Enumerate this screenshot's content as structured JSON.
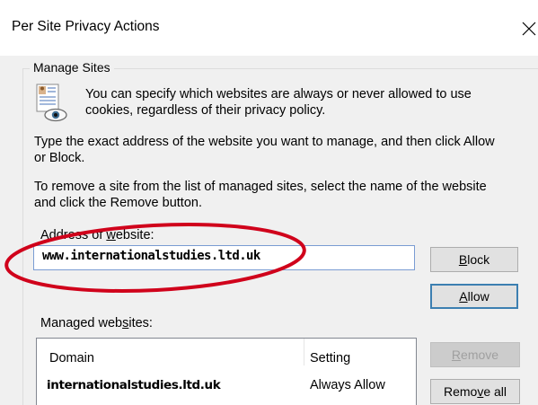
{
  "window": {
    "title": "Per Site Privacy Actions"
  },
  "manage_sites": {
    "legend": "Manage Sites",
    "info_line1": "You can specify which websites are always or never allowed to use",
    "info_line2": "cookies, regardless of their privacy policy.",
    "type_line1": "Type the exact address of the website you want to manage, and then click Allow",
    "type_line2": "or Block.",
    "remove_line1": "To remove a site from the list of managed sites, select the name of the website",
    "remove_line2": "and click the Remove button."
  },
  "address": {
    "label_pre": "Address of ",
    "label_key": "w",
    "label_post": "ebsite:",
    "value": "www.internationalstudies.ltd.uk"
  },
  "buttons": {
    "block_key": "B",
    "block_rest": "lock",
    "allow_key": "A",
    "allow_rest": "llow",
    "remove_key": "R",
    "remove_rest": "emove",
    "remove_all_pre": "Remo",
    "remove_all_key": "v",
    "remove_all_post": "e all"
  },
  "managed": {
    "label_pre": "Managed web",
    "label_key": "s",
    "label_post": "ites:",
    "columns": [
      "Domain",
      "Setting"
    ],
    "rows": [
      {
        "domain": "internationalstudies.ltd.uk",
        "setting": "Always Allow"
      }
    ]
  },
  "colors": {
    "annotation": "#d0021b",
    "accent_border": "#3c7fb1"
  }
}
